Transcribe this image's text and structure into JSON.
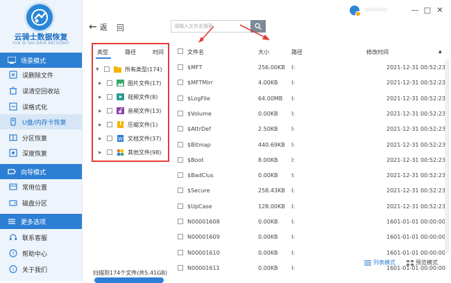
{
  "app": {
    "logo_title": "云骑士数据恢复",
    "logo_sub": "YUN QI SHI DATA RECOVERY",
    "user_name": "********",
    "colors": {
      "primary": "#2d7fd4",
      "highlight": "#e53935",
      "sidebar_bg": "#eef4fb"
    }
  },
  "sidebar": {
    "scene_header": "场景模式",
    "scene_items": [
      {
        "label": "误删除文件",
        "icon": "trash-icon"
      },
      {
        "label": "误清空回收站",
        "icon": "recycle-bin-icon"
      },
      {
        "label": "误格式化",
        "icon": "format-icon"
      },
      {
        "label": "U盘/内存卡恢复",
        "icon": "usb-icon"
      },
      {
        "label": "分区恢复",
        "icon": "partition-icon"
      },
      {
        "label": "深度恢复",
        "icon": "deep-scan-icon"
      }
    ],
    "guide_header": "向导模式",
    "guide_items": [
      {
        "label": "常用位置",
        "icon": "location-icon"
      },
      {
        "label": "磁盘分区",
        "icon": "disk-icon"
      }
    ],
    "more_header": "更多选项",
    "more_items": [
      {
        "label": "联系客服",
        "icon": "headset-icon"
      },
      {
        "label": "帮助中心",
        "icon": "help-icon"
      },
      {
        "label": "关于我们",
        "icon": "info-icon"
      }
    ]
  },
  "toolbar": {
    "back_label": "返",
    "refresh_label": "回",
    "search_placeholder": "请输入文件名搜索"
  },
  "window_controls": {
    "minimize": "—",
    "restore": "□",
    "close": "✕"
  },
  "filter_panel": {
    "tabs": [
      "类型",
      "路径",
      "时间"
    ],
    "items": [
      {
        "label": "所有类型(174)",
        "icon": "folder-icon",
        "color": "#f5b400"
      },
      {
        "label": "图片文件(17)",
        "icon": "image-icon",
        "color": "#3aa86b"
      },
      {
        "label": "视频文件(8)",
        "icon": "video-icon",
        "color": "#2f9b8f"
      },
      {
        "label": "音频文件(13)",
        "icon": "audio-icon",
        "color": "#8e44ad"
      },
      {
        "label": "压缩文件(1)",
        "icon": "zip-icon",
        "color": "#f5b400"
      },
      {
        "label": "文档文件(37)",
        "icon": "document-icon",
        "color": "#2d7fd4"
      },
      {
        "label": "其他文件(98)",
        "icon": "other-files-icon",
        "color": "#e67e22"
      }
    ]
  },
  "table": {
    "columns": [
      "文件名",
      "大小",
      "路径",
      "修改时间"
    ],
    "rows": [
      {
        "name": "$MFT",
        "size": "256.00KB",
        "path": "I:",
        "time": "2021-12-31 00:52:23"
      },
      {
        "name": "$MFTMirr",
        "size": "4.00KB",
        "path": "I:",
        "time": "2021-12-31 00:52:23"
      },
      {
        "name": "$LogFile",
        "size": "64.00MB",
        "path": "I:",
        "time": "2021-12-31 00:52:23"
      },
      {
        "name": "$Volume",
        "size": "0.00KB",
        "path": "I:",
        "time": "2021-12-31 00:52:23"
      },
      {
        "name": "$AttrDef",
        "size": "2.50KB",
        "path": "I:",
        "time": "2021-12-31 00:52:23"
      },
      {
        "name": "$Bitmap",
        "size": "440.69KB",
        "path": "I:",
        "time": "2021-12-31 00:52:23"
      },
      {
        "name": "$Boot",
        "size": "8.00KB",
        "path": "I:",
        "time": "2021-12-31 00:52:23"
      },
      {
        "name": "$BadClus",
        "size": "0.00KB",
        "path": "I:",
        "time": "2021-12-31 00:52:23"
      },
      {
        "name": "$Secure",
        "size": "258.43KB",
        "path": "I:",
        "time": "2021-12-31 00:52:23"
      },
      {
        "name": "$UpCase",
        "size": "128.00KB",
        "path": "I:",
        "time": "2021-12-31 00:52:23"
      },
      {
        "name": "N00001608",
        "size": "0.00KB",
        "path": "I:",
        "time": "1601-01-01 00:00:00"
      },
      {
        "name": "N00001609",
        "size": "0.00KB",
        "path": "I:",
        "time": "1601-01-01 00:00:00"
      },
      {
        "name": "N00001610",
        "size": "0.00KB",
        "path": "I:",
        "time": "1601-01-01 00:00:00"
      },
      {
        "name": "N00001611",
        "size": "0.00KB",
        "path": "I:",
        "time": "1601-01-01 00:00:00"
      }
    ]
  },
  "status": {
    "scan_summary": "扫描到174个文件(共5.41GB)",
    "list_mode": "列表模式",
    "preview_mode": "预览模式"
  }
}
